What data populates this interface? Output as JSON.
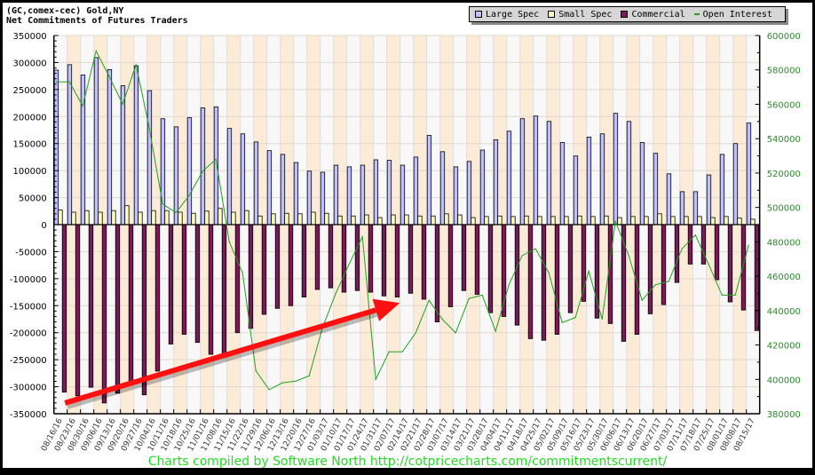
{
  "chart_data": {
    "type": "bar",
    "title": "(GC,comex-cec) Gold,NY",
    "subtitle": "Net Commitments of Futures Traders",
    "footer": "Charts compiled by Software North  http://cotpricecharts.com/commitmentscurrent/",
    "legend": [
      "Large Spec",
      "Small Spec",
      "Commercial",
      "Open Interest"
    ],
    "legend_placement": "top-right",
    "colors": {
      "large": "#c0c0ff",
      "small": "#ffffc0",
      "commercial": "#7a1a5a",
      "oi": "#22a022",
      "band1": "#f8f8f8",
      "band2": "#fcebd6",
      "arrow": "#ff1010",
      "right_axis": "#2a8a2a"
    },
    "categories": [
      "08/16/16",
      "08/23/16",
      "08/30/16",
      "09/06/16",
      "09/13/16",
      "09/20/16",
      "09/27/16",
      "10/04/16",
      "10/11/16",
      "10/18/16",
      "10/25/16",
      "11/01/16",
      "11/08/16",
      "11/15/16",
      "11/22/16",
      "11/29/16",
      "12/06/16",
      "12/13/16",
      "12/20/16",
      "12/27/16",
      "01/03/17",
      "01/10/17",
      "01/17/17",
      "01/24/17",
      "01/31/17",
      "02/07/17",
      "02/14/17",
      "02/21/17",
      "02/28/17",
      "03/07/17",
      "03/14/17",
      "03/21/17",
      "03/28/17",
      "04/04/17",
      "04/11/17",
      "04/18/17",
      "04/25/17",
      "05/02/17",
      "05/09/17",
      "05/16/17",
      "05/23/17",
      "05/30/17",
      "06/06/17",
      "06/13/17",
      "06/20/17",
      "06/27/17",
      "07/03/17",
      "07/11/17",
      "07/18/17",
      "07/25/17",
      "08/01/17",
      "08/08/17",
      "08/15/17"
    ],
    "series": [
      {
        "name": "Large Spec",
        "axis": "left",
        "values": [
          286000,
          296000,
          277000,
          309000,
          287000,
          257000,
          294000,
          248000,
          196000,
          181000,
          198000,
          216000,
          218000,
          178000,
          168000,
          153000,
          137000,
          130000,
          115000,
          99000,
          97000,
          110000,
          107000,
          110000,
          120000,
          119000,
          110000,
          125000,
          165000,
          135000,
          107000,
          117000,
          138000,
          157000,
          173000,
          196000,
          201000,
          191000,
          152000,
          127000,
          162000,
          168000,
          206000,
          191000,
          152000,
          132000,
          94000,
          61000,
          61000,
          92000,
          130000,
          150000,
          188000
        ]
      },
      {
        "name": "Small Spec",
        "axis": "left",
        "values": [
          27000,
          23000,
          26000,
          23000,
          26000,
          35000,
          23000,
          26000,
          26000,
          23000,
          21000,
          25000,
          30000,
          23000,
          26000,
          16000,
          20000,
          21000,
          20000,
          23000,
          21000,
          16000,
          16000,
          18000,
          13000,
          18000,
          18000,
          16000,
          16000,
          20000,
          18000,
          13000,
          15000,
          16000,
          15000,
          16000,
          15000,
          15000,
          15000,
          16000,
          15000,
          16000,
          13000,
          15000,
          15000,
          20000,
          15000,
          15000,
          15000,
          13000,
          15000,
          12000,
          10000
        ]
      },
      {
        "name": "Commercial",
        "axis": "left",
        "values": [
          -310000,
          -317000,
          -301000,
          -330000,
          -312000,
          -291000,
          -315000,
          -271000,
          -221000,
          -203000,
          -218000,
          -240000,
          -246000,
          -200000,
          -192000,
          -166000,
          -155000,
          -150000,
          -134000,
          -120000,
          -117000,
          -125000,
          -122000,
          -125000,
          -132000,
          -134000,
          -127000,
          -138000,
          -180000,
          -152000,
          -122000,
          -129000,
          -163000,
          -170000,
          -186000,
          -211000,
          -214000,
          -203000,
          -163000,
          -142000,
          -173000,
          -183000,
          -216000,
          -203000,
          -165000,
          -148000,
          -107000,
          -73000,
          -73000,
          -102000,
          -143000,
          -158000,
          -196000
        ]
      },
      {
        "name": "Open Interest",
        "axis": "right",
        "type": "line",
        "values": [
          573000,
          573000,
          559000,
          591000,
          576000,
          560000,
          583000,
          546000,
          502000,
          497000,
          507000,
          521000,
          528000,
          480000,
          462000,
          405000,
          394000,
          398000,
          399000,
          402000,
          430000,
          450000,
          467000,
          483000,
          400000,
          416000,
          416000,
          427000,
          446000,
          435000,
          427000,
          447000,
          449000,
          428000,
          455000,
          472000,
          476000,
          462000,
          433000,
          436000,
          463000,
          435000,
          492000,
          472000,
          446000,
          455000,
          457000,
          476000,
          484000,
          467000,
          449000,
          449000,
          478000
        ]
      }
    ],
    "ylim": [
      -350000,
      350000
    ],
    "yticks": [
      350000,
      300000,
      250000,
      200000,
      150000,
      100000,
      50000,
      0,
      -50000,
      -100000,
      -150000,
      -200000,
      -250000,
      -300000,
      -350000
    ],
    "ylim_right": [
      380000,
      600000
    ],
    "yticks_right": [
      600000,
      580000,
      560000,
      540000,
      520000,
      500000,
      480000,
      460000,
      440000,
      420000,
      400000,
      380000
    ],
    "grid": true,
    "annotations": [
      {
        "type": "arrow",
        "from": {
          "date": "08/23/16",
          "value": -330000
        },
        "to": {
          "date": "02/14/17",
          "value": -145000
        }
      }
    ]
  }
}
